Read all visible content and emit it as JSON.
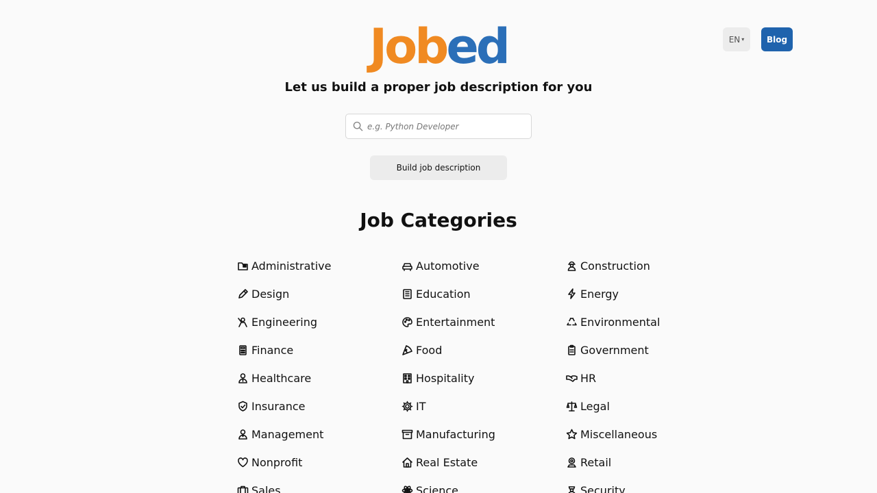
{
  "header": {
    "logo_part1": "Job",
    "logo_part2": "ed",
    "language": "EN",
    "blog_label": "Blog"
  },
  "hero": {
    "tagline": "Let us build a proper job description for you",
    "search_placeholder": "e.g. Python Developer",
    "search_value": "",
    "build_label": "Build job description"
  },
  "categories": {
    "title": "Job Categories",
    "items": [
      {
        "label": "Administrative",
        "icon": "folder-icon"
      },
      {
        "label": "Automotive",
        "icon": "car-icon"
      },
      {
        "label": "Construction",
        "icon": "hardhat-worker-icon"
      },
      {
        "label": "Design",
        "icon": "pencil-icon"
      },
      {
        "label": "Education",
        "icon": "book-icon"
      },
      {
        "label": "Energy",
        "icon": "lightning-icon"
      },
      {
        "label": "Engineering",
        "icon": "engineer-icon"
      },
      {
        "label": "Entertainment",
        "icon": "palette-icon"
      },
      {
        "label": "Environmental",
        "icon": "recycle-icon"
      },
      {
        "label": "Finance",
        "icon": "calculator-icon"
      },
      {
        "label": "Food",
        "icon": "pizza-icon"
      },
      {
        "label": "Government",
        "icon": "clipboard-icon"
      },
      {
        "label": "Healthcare",
        "icon": "doctor-icon"
      },
      {
        "label": "Hospitality",
        "icon": "hotel-icon"
      },
      {
        "label": "HR",
        "icon": "handshake-icon"
      },
      {
        "label": "Insurance",
        "icon": "shield-check-icon"
      },
      {
        "label": "IT",
        "icon": "gear-icon"
      },
      {
        "label": "Legal",
        "icon": "scales-icon"
      },
      {
        "label": "Management",
        "icon": "manager-icon"
      },
      {
        "label": "Manufacturing",
        "icon": "archive-box-icon"
      },
      {
        "label": "Miscellaneous",
        "icon": "star-icon"
      },
      {
        "label": "Nonprofit",
        "icon": "heart-icon"
      },
      {
        "label": "Real Estate",
        "icon": "house-icon"
      },
      {
        "label": "Retail",
        "icon": "cashier-icon"
      },
      {
        "label": "Sales",
        "icon": "briefcase-icon"
      },
      {
        "label": "Science",
        "icon": "atom-icon"
      },
      {
        "label": "Security",
        "icon": "guard-icon"
      }
    ]
  },
  "colors": {
    "logo_orange": "#f08a22",
    "logo_blue": "#2b6fb8",
    "blog_button": "#1f63ad"
  }
}
